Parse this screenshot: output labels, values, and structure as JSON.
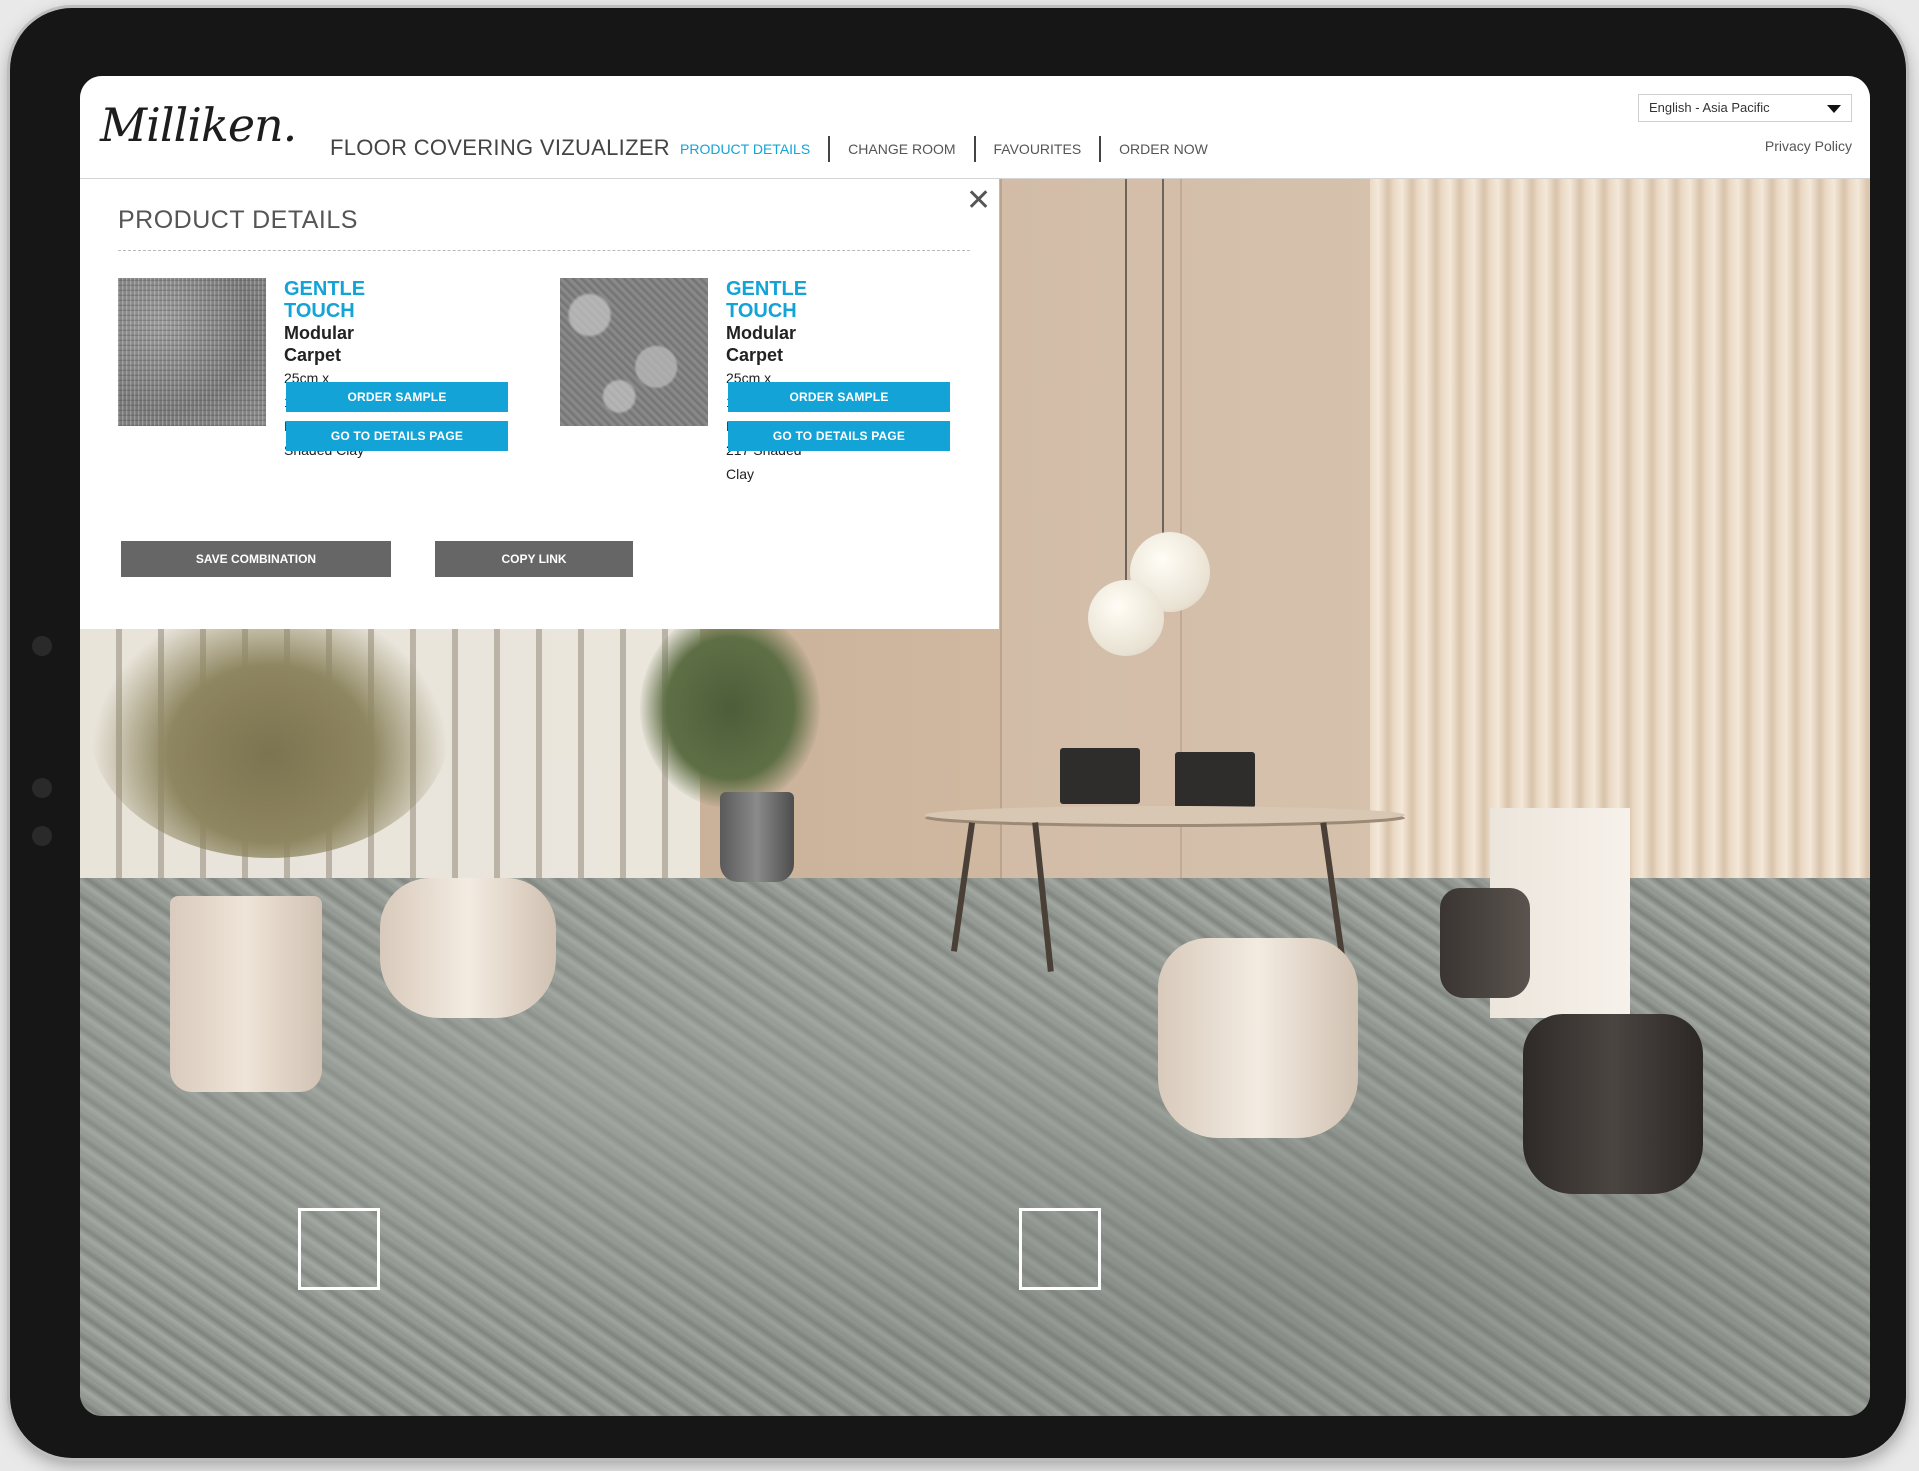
{
  "header": {
    "logo_text": "Milliken.",
    "app_title": "FLOOR COVERING VIZUALIZER",
    "nav": [
      {
        "label": "PRODUCT DETAILS",
        "active": true
      },
      {
        "label": "CHANGE ROOM",
        "active": false
      },
      {
        "label": "FAVOURITES",
        "active": false
      },
      {
        "label": "ORDER NOW",
        "active": false
      }
    ],
    "language": "English - Asia Pacific",
    "privacy_link": "Privacy Policy"
  },
  "panel": {
    "title": "PRODUCT DETAILS",
    "close_icon": "close-icon",
    "products": [
      {
        "name": "GENTLE TOUCH",
        "type": "Modular Carpet",
        "size": "25cm x 100cm",
        "code": "BSD235-217 Shaded Clay",
        "order_label": "ORDER SAMPLE",
        "details_label": "GO TO DETAILS PAGE"
      },
      {
        "name": "GENTLE TOUCH",
        "type": "Modular Carpet",
        "size": "25cm x 100cm",
        "code": "FWC235-217 Shaded Clay",
        "order_label": "ORDER SAMPLE",
        "details_label": "GO TO DETAILS PAGE"
      }
    ],
    "save_label": "SAVE COMBINATION",
    "copy_label": "COPY LINK"
  },
  "colors": {
    "accent": "#14a3d6",
    "button_gray": "#666666",
    "device_bezel": "#161616"
  }
}
